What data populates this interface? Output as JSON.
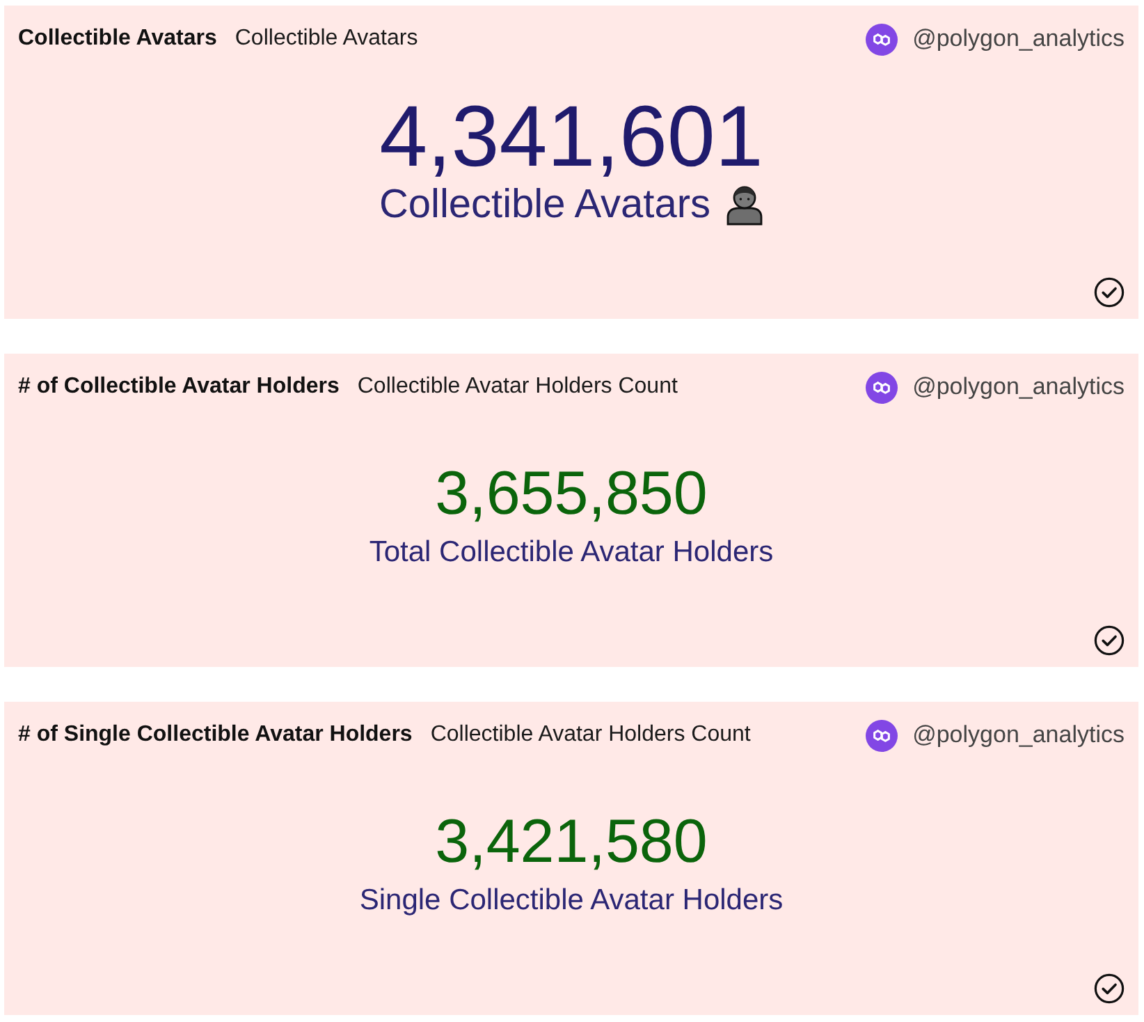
{
  "cards": [
    {
      "kind": "hero",
      "title": "Collectible Avatars",
      "subtitle": "Collectible Avatars",
      "author": "@polygon_analytics",
      "value": "4,341,601",
      "color": "#201b6d",
      "label": "Collectible Avatars"
    },
    {
      "kind": "standard",
      "title": "# of Collectible Avatar Holders",
      "subtitle": "Collectible Avatar Holders Count",
      "author": "@polygon_analytics",
      "value": "3,655,850",
      "color": "#0b640b",
      "label": "Total Collectible Avatar Holders"
    },
    {
      "kind": "standard",
      "title": "# of Single Collectible Avatar Holders",
      "subtitle": "Collectible Avatar Holders Count",
      "author": "@polygon_analytics",
      "value": "3,421,580",
      "color": "#0b640b",
      "label": "Single Collectible Avatar Holders"
    }
  ]
}
